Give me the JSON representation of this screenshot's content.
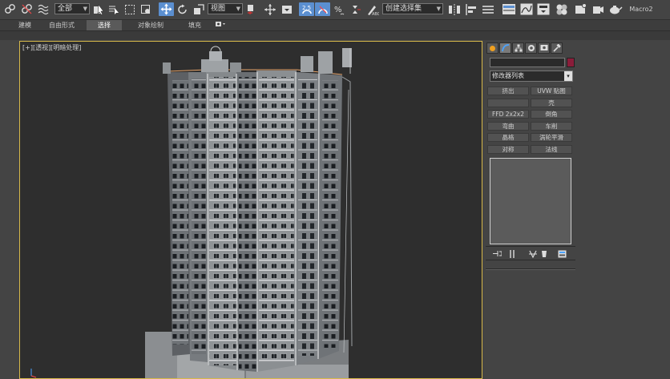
{
  "toolbar": {
    "filter_value": "全部",
    "view_value": "视图",
    "snap_value": "2.5",
    "selection_set_placeholder": "创建选择集",
    "macro_label": "Macro2"
  },
  "ribbon": {
    "tabs": [
      {
        "label": "建模"
      },
      {
        "label": "自由形式"
      },
      {
        "label": "选择"
      },
      {
        "label": "对象绘制"
      },
      {
        "label": "填充"
      }
    ],
    "extra_icon": "camera-icon"
  },
  "viewport": {
    "label": "[+][透视][明暗处理]"
  },
  "panel": {
    "tab_icons": [
      "sun-icon",
      "arc-icon",
      "hierarchy-icon",
      "circle-icon",
      "monitor-icon",
      "hammer-icon"
    ],
    "modifier_list": "修改器列表",
    "modifiers": [
      [
        "挤出",
        "UVW 贴图"
      ],
      [
        "",
        "壳"
      ],
      [
        "FFD 2x2x2",
        "倒角"
      ],
      [
        "弯曲",
        "车削"
      ],
      [
        "晶格",
        "涡轮平滑"
      ],
      [
        "对称",
        "法线"
      ]
    ],
    "swatch_color": "#8a1d3a"
  }
}
